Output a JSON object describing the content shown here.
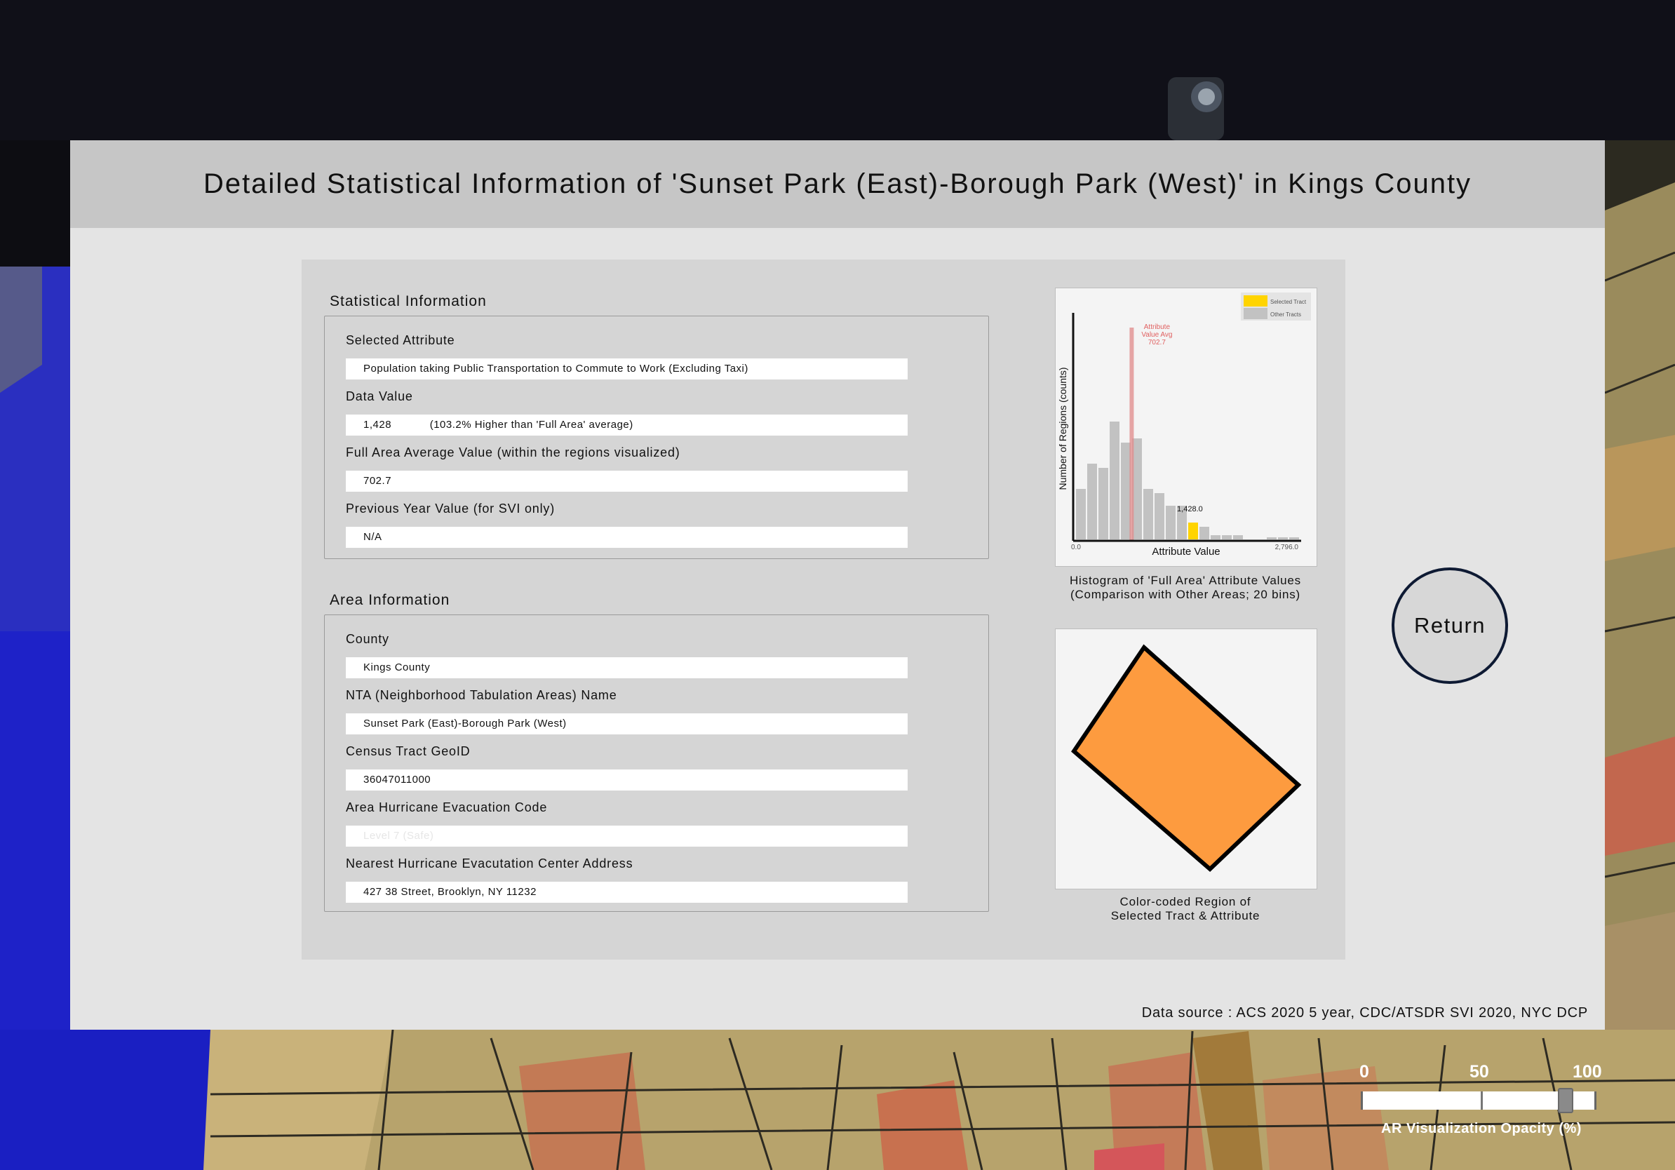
{
  "dialog": {
    "title": "Detailed Statistical Information of 'Sunset Park (East)-Borough Park (West)' in Kings County",
    "data_source": "Data source : ACS 2020 5 year, CDC/ATSDR SVI 2020, NYC DCP",
    "return_label": "Return"
  },
  "statistical_info": {
    "section_title": "Statistical Information",
    "selected_attribute_label": "Selected Attribute",
    "selected_attribute_value": "Population taking Public Transportation to Commute to Work (Excluding Taxi)",
    "data_value_label": "Data Value",
    "data_value": "1,428",
    "data_value_comparison": "(103.2% Higher than 'Full Area' average)",
    "full_area_avg_label": "Full Area Average Value (within the regions visualized)",
    "full_area_avg_value": "702.7",
    "previous_year_label": "Previous Year Value (for SVI only)",
    "previous_year_value": "N/A"
  },
  "area_info": {
    "section_title": "Area Information",
    "county_label": "County",
    "county_value": "Kings County",
    "nta_label": "NTA (Neighborhood Tabulation Areas) Name",
    "nta_value": "Sunset Park (East)-Borough Park (West)",
    "geoid_label": "Census Tract GeoID",
    "geoid_value": "36047011000",
    "evac_code_label": "Area Hurricane Evacuation Code",
    "evac_code_value": "Level 7 (Safe)",
    "evac_center_label": "Nearest Hurricane Evacutation Center Address",
    "evac_center_value": "427 38 Street, Brooklyn, NY 11232"
  },
  "histogram_caption_line1": "Histogram of 'Full Area' Attribute Values",
  "histogram_caption_line2": "(Comparison with Other Areas; 20 bins)",
  "region_caption_line1": "Color-coded Region of",
  "region_caption_line2": "Selected Tract & Attribute",
  "region_color": "#fd9b3f",
  "chart_data": {
    "type": "bar",
    "title": "",
    "xlabel": "Attribute Value",
    "ylabel": "Number of Regions (counts)",
    "x_min_label": "0.0",
    "x_max_label": "2,796.0",
    "xlim": [
      0,
      2796
    ],
    "bins": 20,
    "values": [
      12,
      18,
      17,
      28,
      23,
      24,
      12,
      11,
      8,
      8,
      4,
      3,
      1,
      1,
      1,
      0,
      0,
      0.5,
      0.5,
      0.5
    ],
    "selected_bin": 10,
    "selected_value": 1428.0,
    "selected_value_label": "1,428.0",
    "average_value": 702.7,
    "average_label_lines": [
      "Attribute",
      "Value Avg",
      "702.7"
    ],
    "legend": {
      "position": "top-right",
      "entries": [
        {
          "name": "Selected Tract",
          "color": "#ffd400"
        },
        {
          "name": "Other Tracts",
          "color": "#c2c2c2"
        }
      ]
    },
    "colors": {
      "bar": "#c2c2c2",
      "selected": "#ffd400",
      "average_line": "#e08a8a",
      "average_text": "#e06060"
    }
  },
  "opacity_slider": {
    "caption": "AR Visualization Opacity (%)",
    "tick_labels": [
      "0",
      "50",
      "100"
    ],
    "value": 87
  }
}
